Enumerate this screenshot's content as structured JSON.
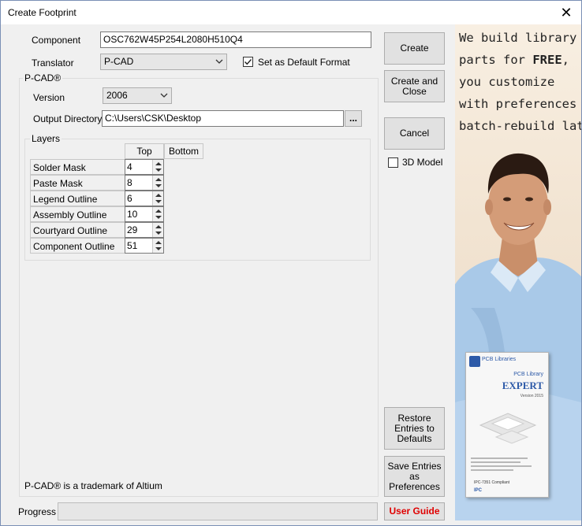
{
  "window": {
    "title": "Create Footprint"
  },
  "component": {
    "label": "Component",
    "value": "OSC762W45P254L2080H510Q4"
  },
  "translator": {
    "label": "Translator",
    "value": "P-CAD",
    "default_label": "Set as Default Format",
    "default_checked": true
  },
  "pcad": {
    "group_label": "P-CAD®",
    "version_label": "Version",
    "version_value": "2006",
    "output_label": "Output Directory",
    "output_value": "C:\\Users\\CSK\\Desktop",
    "browse_label": "..."
  },
  "layers": {
    "group_label": "Layers",
    "col_top": "Top",
    "col_bottom": "Bottom",
    "rows": [
      {
        "name": "Solder Mask",
        "top": "4"
      },
      {
        "name": "Paste Mask",
        "top": "8"
      },
      {
        "name": "Legend Outline",
        "top": "6"
      },
      {
        "name": "Assembly Outline",
        "top": "10"
      },
      {
        "name": "Courtyard Outline",
        "top": "29"
      },
      {
        "name": "Component Outline",
        "top": "51"
      }
    ]
  },
  "buttons": {
    "create": "Create",
    "create_close_1": "Create and",
    "create_close_2": "Close",
    "cancel": "Cancel",
    "restore_1": "Restore",
    "restore_2": "Entries to",
    "restore_3": "Defaults",
    "save_1": "Save Entries",
    "save_2": "as",
    "save_3": "Preferences",
    "user_guide": "User Guide"
  },
  "model3d": {
    "label": "3D Model",
    "checked": false
  },
  "trademark": "P-CAD® is a trademark of Altium",
  "progress": {
    "label": "Progress",
    "value": 0
  },
  "ad": {
    "line1": "We build library",
    "line2a": "parts for ",
    "line2b": "FREE",
    "line2c": ",",
    "line3": "you customize",
    "line4": "with preferences &",
    "line5": "batch-rebuild later!",
    "box_brand": "PCB Libraries",
    "box_product": "PCB Library",
    "box_edition": "EXPERT",
    "box_version": "Version 2015",
    "box_compliant": "IPC-7351 Compliant",
    "box_ipc": "IPC"
  },
  "colors": {
    "user_guide_text": "#e00000",
    "window_border": "#7a8fb5"
  }
}
